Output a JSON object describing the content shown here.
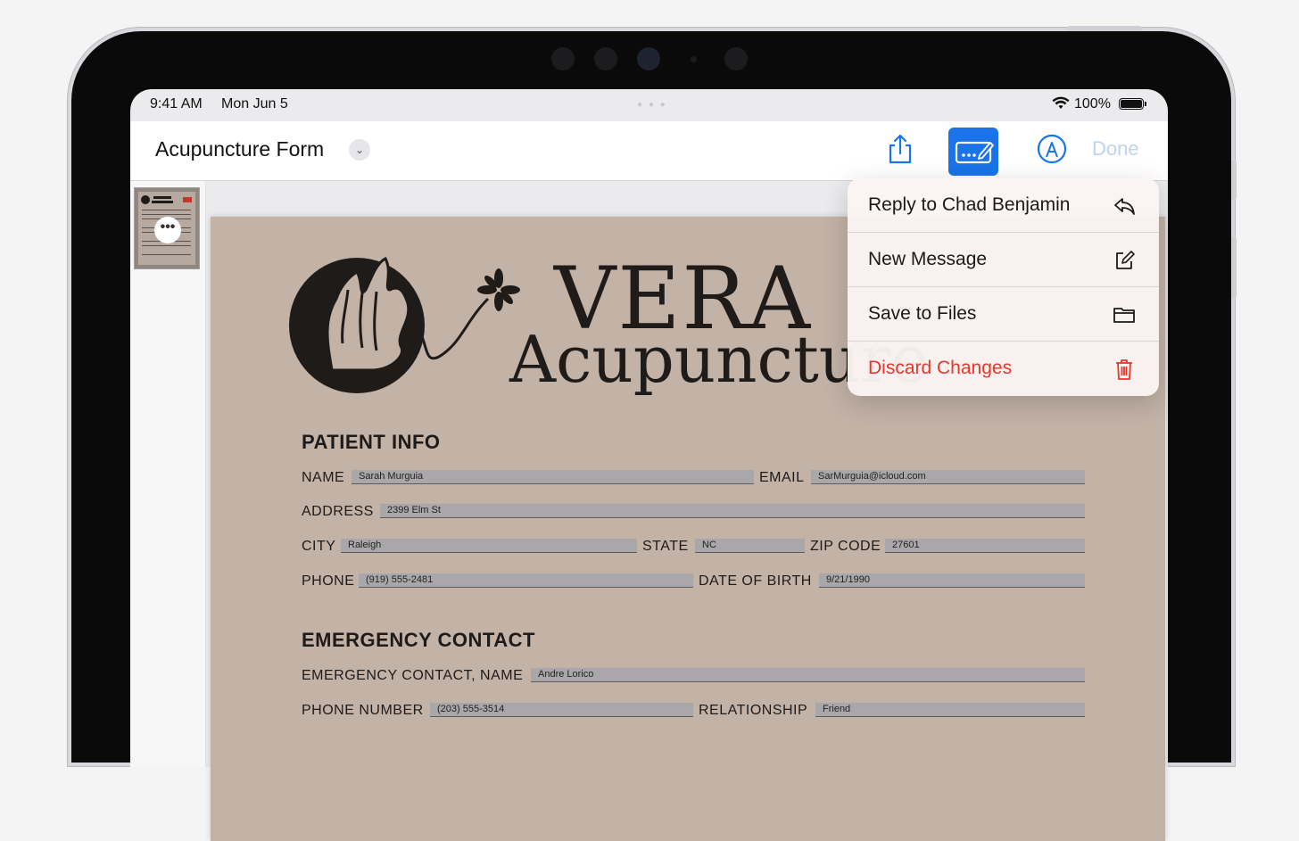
{
  "status_bar": {
    "time": "9:41 AM",
    "date": "Mon Jun 5",
    "battery_percent": "100%",
    "battery_level": 1.0
  },
  "toolbar": {
    "document_title": "Acupuncture Form",
    "done_label": "Done",
    "accent_color": "#1a73e8"
  },
  "menu": {
    "items": [
      {
        "label": "Reply to Chad Benjamin",
        "icon": "reply-icon",
        "destructive": false
      },
      {
        "label": "New Message",
        "icon": "compose-icon",
        "destructive": false
      },
      {
        "label": "Save to Files",
        "icon": "folder-icon",
        "destructive": false
      },
      {
        "label": "Discard Changes",
        "icon": "trash-icon",
        "destructive": true
      }
    ],
    "destructive_color": "#e5372c"
  },
  "document": {
    "brand_line1": "VERA",
    "brand_line2": "Acupuncture",
    "patient_section": "PATIENT INFO",
    "emergency_section": "EMERGENCY CONTACT",
    "fields": {
      "name_label": "NAME",
      "name_value": "Sarah Murguia",
      "email_label": "EMAIL",
      "email_value": "SarMurguia@icloud.com",
      "address_label": "ADDRESS",
      "address_value": "2399 Elm St",
      "city_label": "CITY",
      "city_value": "Raleigh",
      "state_label": "STATE",
      "state_value": "NC",
      "zip_label": "ZIP CODE",
      "zip_value": "27601",
      "phone_label": "PHONE",
      "phone_value": "(919) 555-2481",
      "dob_label": "DATE OF BIRTH",
      "dob_value": "9/21/1990",
      "ec_name_label": "EMERGENCY CONTACT, NAME",
      "ec_name_value": "Andre Lorico",
      "ec_phone_label": "PHONE NUMBER",
      "ec_phone_value": "(203) 555-3514",
      "relationship_label": "RELATIONSHIP",
      "relationship_value": "Friend"
    }
  }
}
